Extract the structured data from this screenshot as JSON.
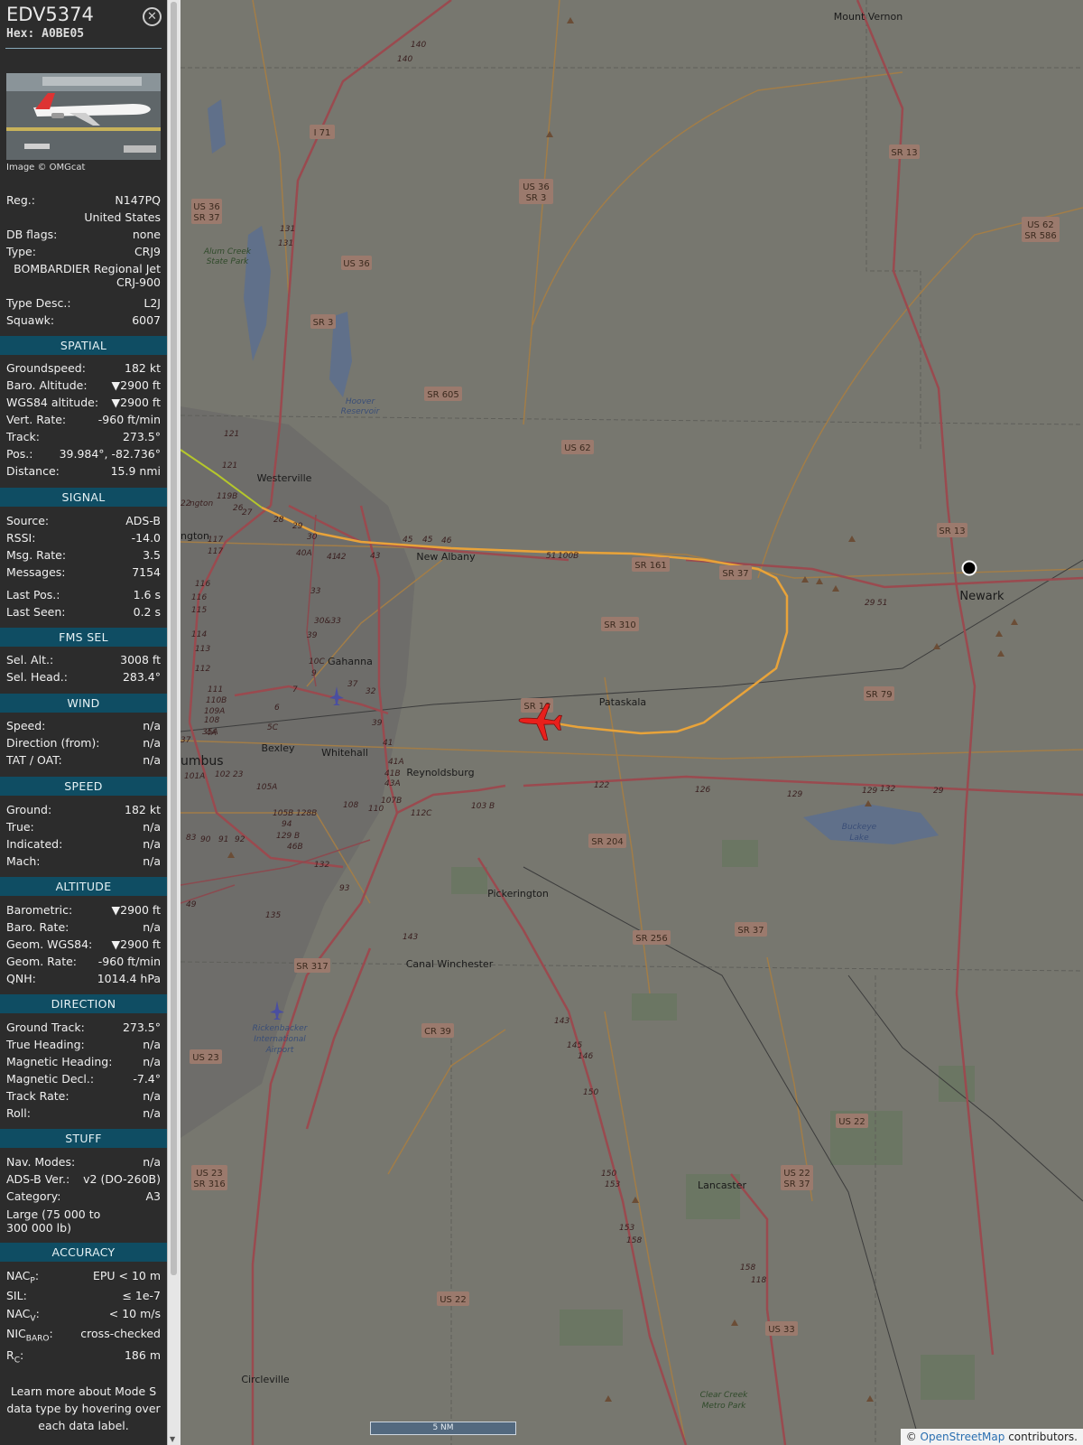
{
  "header": {
    "callsign": "EDV5374",
    "hex": "Hex: A0BE05",
    "close_icon": "close-circle-icon"
  },
  "photo": {
    "credit": "Image © OMGcat"
  },
  "aircraft": {
    "reg_label": "Reg.:",
    "reg": "N147PQ",
    "country": "United States",
    "dbflags_label": "DB flags:",
    "dbflags": "none",
    "type_label": "Type:",
    "type": "CRJ9",
    "model_line1": "BOMBARDIER Regional Jet",
    "model_line2": "CRJ-900",
    "typedesc_label": "Type Desc.:",
    "typedesc": "L2J",
    "squawk_label": "Squawk:",
    "squawk": "6007"
  },
  "spatial": {
    "title": "SPATIAL",
    "rows": [
      {
        "label": "Groundspeed:",
        "value": "182 kt"
      },
      {
        "label": "Baro. Altitude:",
        "value": "▼2900 ft"
      },
      {
        "label": "WGS84 altitude:",
        "value": "▼2900 ft"
      },
      {
        "label": "Vert. Rate:",
        "value": "-960 ft/min"
      },
      {
        "label": "Track:",
        "value": "273.5°"
      },
      {
        "label": "Pos.:",
        "value": "39.984°, -82.736°"
      },
      {
        "label": "Distance:",
        "value": "15.9 nmi"
      }
    ]
  },
  "signal": {
    "title": "SIGNAL",
    "rows": [
      {
        "label": "Source:",
        "value": "ADS-B"
      },
      {
        "label": "RSSI:",
        "value": "-14.0"
      },
      {
        "label": "Msg. Rate:",
        "value": "3.5"
      },
      {
        "label": "Messages:",
        "value": "7154"
      },
      {
        "label": "Last Pos.:",
        "value": "1.6 s"
      },
      {
        "label": "Last Seen:",
        "value": "0.2 s"
      }
    ]
  },
  "fms": {
    "title": "FMS SEL",
    "rows": [
      {
        "label": "Sel. Alt.:",
        "value": "3008 ft"
      },
      {
        "label": "Sel. Head.:",
        "value": "283.4°"
      }
    ]
  },
  "wind": {
    "title": "WIND",
    "rows": [
      {
        "label": "Speed:",
        "value": "n/a"
      },
      {
        "label": "Direction (from):",
        "value": "n/a"
      },
      {
        "label": "TAT / OAT:",
        "value": "n/a"
      }
    ]
  },
  "speed": {
    "title": "SPEED",
    "rows": [
      {
        "label": "Ground:",
        "value": "182 kt"
      },
      {
        "label": "True:",
        "value": "n/a"
      },
      {
        "label": "Indicated:",
        "value": "n/a"
      },
      {
        "label": "Mach:",
        "value": "n/a"
      }
    ]
  },
  "altitude": {
    "title": "ALTITUDE",
    "rows": [
      {
        "label": "Barometric:",
        "value": "▼2900 ft"
      },
      {
        "label": "Baro. Rate:",
        "value": "n/a"
      },
      {
        "label": "Geom. WGS84:",
        "value": "▼2900 ft"
      },
      {
        "label": "Geom. Rate:",
        "value": "-960 ft/min"
      },
      {
        "label": "QNH:",
        "value": "1014.4 hPa"
      }
    ]
  },
  "direction": {
    "title": "DIRECTION",
    "rows": [
      {
        "label": "Ground Track:",
        "value": "273.5°"
      },
      {
        "label": "True Heading:",
        "value": "n/a"
      },
      {
        "label": "Magnetic Heading:",
        "value": "n/a"
      },
      {
        "label": "Magnetic Decl.:",
        "value": "-7.4°"
      },
      {
        "label": "Track Rate:",
        "value": "n/a"
      },
      {
        "label": "Roll:",
        "value": "n/a"
      }
    ]
  },
  "stuff": {
    "title": "STUFF",
    "rows": [
      {
        "label": "Nav. Modes:",
        "value": "n/a"
      },
      {
        "label": "ADS-B Ver.:",
        "value": "v2 (DO-260B)"
      },
      {
        "label": "Category:",
        "value": "A3"
      }
    ],
    "category_desc": "Large (75 000 to 300 000 lb)"
  },
  "accuracy": {
    "title": "ACCURACY",
    "nacp_label": "NAC",
    "nacp_sub": "P",
    "nacp_value": "EPU < 10 m",
    "sil_label": "SIL:",
    "sil_value": "≤ 1e-7",
    "nacv_label": "NAC",
    "nacv_sub": "V",
    "nacv_value": "< 10 m/s",
    "nicbaro_label": "NIC",
    "nicbaro_sub": "BARO",
    "nicbaro_value": "cross-checked",
    "rc_label": "R",
    "rc_sub": "C",
    "rc_value": "186 m"
  },
  "footer_note": "Learn more about Mode S data type by hovering over each data label.",
  "map": {
    "scale_label": "5 NM",
    "attribution_prefix": "©",
    "attribution_link": "OpenStreetMap",
    "attribution_suffix": "contributors.",
    "towns": [
      "Mount Vernon",
      "Westerville",
      "New Albany",
      "Newark",
      "Gahanna",
      "Pataskala",
      "Bexley",
      "Whitehall",
      "umbus",
      "Reynoldsburg",
      "Pickerington",
      "Canal Winchester",
      "Lancaster",
      "Circleville",
      "ngton"
    ],
    "parks": [
      "Alum Creek",
      "State Park",
      "Clear Creek",
      "Metro Park"
    ],
    "waters": [
      "Hoover",
      "Reservoir",
      "Buckeye",
      "Lake"
    ],
    "airport": [
      "Rickenbacker",
      "International",
      "Airport"
    ],
    "shields": [
      "I 71",
      "US 36",
      "SR 3",
      "US 36",
      "SR 37",
      "US 36",
      "SR 3",
      "SR 13",
      "US 62",
      "SR 586",
      "SR 605",
      "US 62",
      "SR 13",
      "SR 161",
      "SR 37",
      "SR 310",
      "SR 16",
      "SR 79",
      "SR 204",
      "SR 256",
      "SR 37",
      "SR 317",
      "CR 39",
      "US 23",
      "US 22",
      "US 23",
      "SR 316",
      "US 22",
      "SR 37",
      "US 22",
      "US 33"
    ],
    "exits": [
      "140",
      "140",
      "131",
      "131",
      "121",
      "121",
      "119B",
      "26",
      "27",
      "28",
      "29",
      "30",
      "40A",
      "41",
      "42",
      "43",
      "45",
      "45",
      "46",
      "117",
      "117",
      "116",
      "116",
      "115",
      "114",
      "113",
      "112",
      "111",
      "110B",
      "109A",
      "108",
      "35A",
      "10C",
      "9",
      "7",
      "6",
      "5C",
      "4A",
      "37",
      "37",
      "32",
      "33",
      "30&33",
      "39",
      "39",
      "41",
      "41A",
      "41B",
      "43A",
      "107B",
      "108",
      "110",
      "112C",
      "103 B",
      "105A",
      "105B",
      "128B",
      "94",
      "129 B",
      "46B",
      "132",
      "93",
      "92",
      "91",
      "90",
      "83",
      "49",
      "135",
      "143",
      "143",
      "145",
      "146",
      "150",
      "150",
      "153",
      "153",
      "158",
      "158",
      "118",
      "122",
      "126",
      "129",
      "129",
      "132",
      "29",
      "29",
      "51",
      "51",
      "100B",
      "101A",
      "102",
      "23",
      "22",
      "ngton"
    ],
    "icons": [
      "aircraft-icon",
      "receiver-marker-icon",
      "airport-icon"
    ]
  }
}
